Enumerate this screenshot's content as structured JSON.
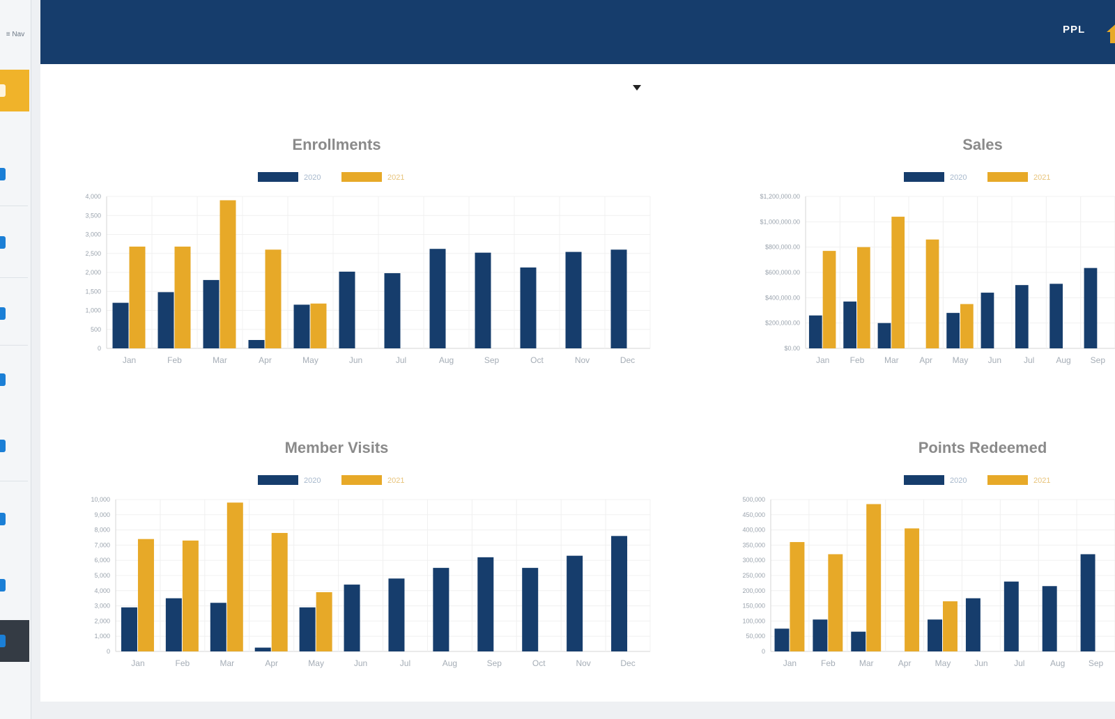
{
  "sidebar": {
    "top_label": "≡ Nav",
    "items": [
      {
        "name": "sidebar-item-dashboard",
        "state": "active",
        "icon": "dashboard-icon"
      },
      {
        "name": "sidebar-item-2",
        "state": "normal",
        "icon": "menu-icon"
      },
      {
        "name": "sidebar-item-3",
        "state": "normal",
        "icon": "menu-icon"
      },
      {
        "name": "sidebar-item-4",
        "state": "normal",
        "icon": "menu-icon"
      },
      {
        "name": "sidebar-item-5",
        "state": "normal",
        "icon": "menu-icon"
      },
      {
        "name": "sidebar-item-6",
        "state": "normal",
        "icon": "menu-icon"
      },
      {
        "name": "sidebar-item-7",
        "state": "normal",
        "icon": "menu-icon"
      },
      {
        "name": "sidebar-item-8",
        "state": "normal",
        "icon": "menu-icon"
      },
      {
        "name": "sidebar-item-collapse",
        "state": "dark",
        "icon": "chevron-right-icon"
      }
    ]
  },
  "header": {
    "user_initials": "PPL",
    "home_icon": "home-icon",
    "background_color": "#163d6c"
  },
  "colors": {
    "series_2020": "#163d6c",
    "series_2021": "#e7a928"
  },
  "chart_data": [
    {
      "type": "bar",
      "title": "Enrollments",
      "categories": [
        "Jan",
        "Feb",
        "Mar",
        "Apr",
        "May",
        "Jun",
        "Jul",
        "Aug",
        "Sep",
        "Oct",
        "Nov",
        "Dec"
      ],
      "series": [
        {
          "name": "2020",
          "values": [
            1200,
            1480,
            1800,
            220,
            1150,
            2020,
            1980,
            2620,
            2520,
            2130,
            2540,
            2600
          ]
        },
        {
          "name": "2021",
          "values": [
            2680,
            2680,
            3900,
            2600,
            1180,
            null,
            null,
            null,
            null,
            null,
            null,
            null
          ]
        }
      ],
      "yticks": [
        "4,000",
        "3,500",
        "3,000",
        "2,500",
        "2,000",
        "1,500",
        "1,000",
        "500",
        "0"
      ],
      "ylim": [
        0,
        4000
      ],
      "legend": "top",
      "grid": true
    },
    {
      "type": "bar",
      "title": "Sales",
      "categories": [
        "Jan",
        "Feb",
        "Mar",
        "Apr",
        "May",
        "Jun",
        "Jul",
        "Aug",
        "Sep"
      ],
      "series": [
        {
          "name": "2020",
          "values": [
            260000,
            370000,
            200000,
            null,
            280000,
            440000,
            500000,
            510000,
            635000
          ]
        },
        {
          "name": "2021",
          "values": [
            770000,
            800000,
            1040000,
            860000,
            350000,
            null,
            null,
            null,
            null
          ]
        }
      ],
      "yticks": [
        "$1,200,000.00",
        "$1,000,000.00",
        "$800,000.00",
        "$600,000.00",
        "$400,000.00",
        "$200,000.00",
        "$0.00"
      ],
      "ylim": [
        0,
        1200000
      ],
      "legend": "top",
      "grid": true
    },
    {
      "type": "bar",
      "title": "Member Visits",
      "categories": [
        "Jan",
        "Feb",
        "Mar",
        "Apr",
        "May",
        "Jun",
        "Jul",
        "Aug",
        "Sep",
        "Oct",
        "Nov",
        "Dec"
      ],
      "series": [
        {
          "name": "2020",
          "values": [
            2900,
            3500,
            3200,
            250,
            2900,
            4400,
            4800,
            5500,
            6200,
            5500,
            6300,
            7600
          ]
        },
        {
          "name": "2021",
          "values": [
            7400,
            7300,
            9800,
            7800,
            3900,
            null,
            null,
            null,
            null,
            null,
            null,
            null
          ]
        }
      ],
      "yticks": [
        "10,000",
        "9,000",
        "8,000",
        "7,000",
        "6,000",
        "5,000",
        "4,000",
        "3,000",
        "2,000",
        "1,000",
        "0"
      ],
      "ylim": [
        0,
        10000
      ],
      "legend": "top",
      "grid": true
    },
    {
      "type": "bar",
      "title": "Points Redeemed",
      "categories": [
        "Jan",
        "Feb",
        "Mar",
        "Apr",
        "May",
        "Jun",
        "Jul",
        "Aug",
        "Sep"
      ],
      "series": [
        {
          "name": "2020",
          "values": [
            75000,
            105000,
            65000,
            null,
            105000,
            175000,
            230000,
            215000,
            320000
          ]
        },
        {
          "name": "2021",
          "values": [
            360000,
            320000,
            485000,
            405000,
            165000,
            null,
            null,
            null,
            null
          ]
        }
      ],
      "yticks": [
        "500,000",
        "450,000",
        "400,000",
        "350,000",
        "300,000",
        "250,000",
        "200,000",
        "150,000",
        "100,000",
        "50,000",
        "0"
      ],
      "ylim": [
        0,
        500000
      ],
      "legend": "top",
      "grid": true
    }
  ]
}
